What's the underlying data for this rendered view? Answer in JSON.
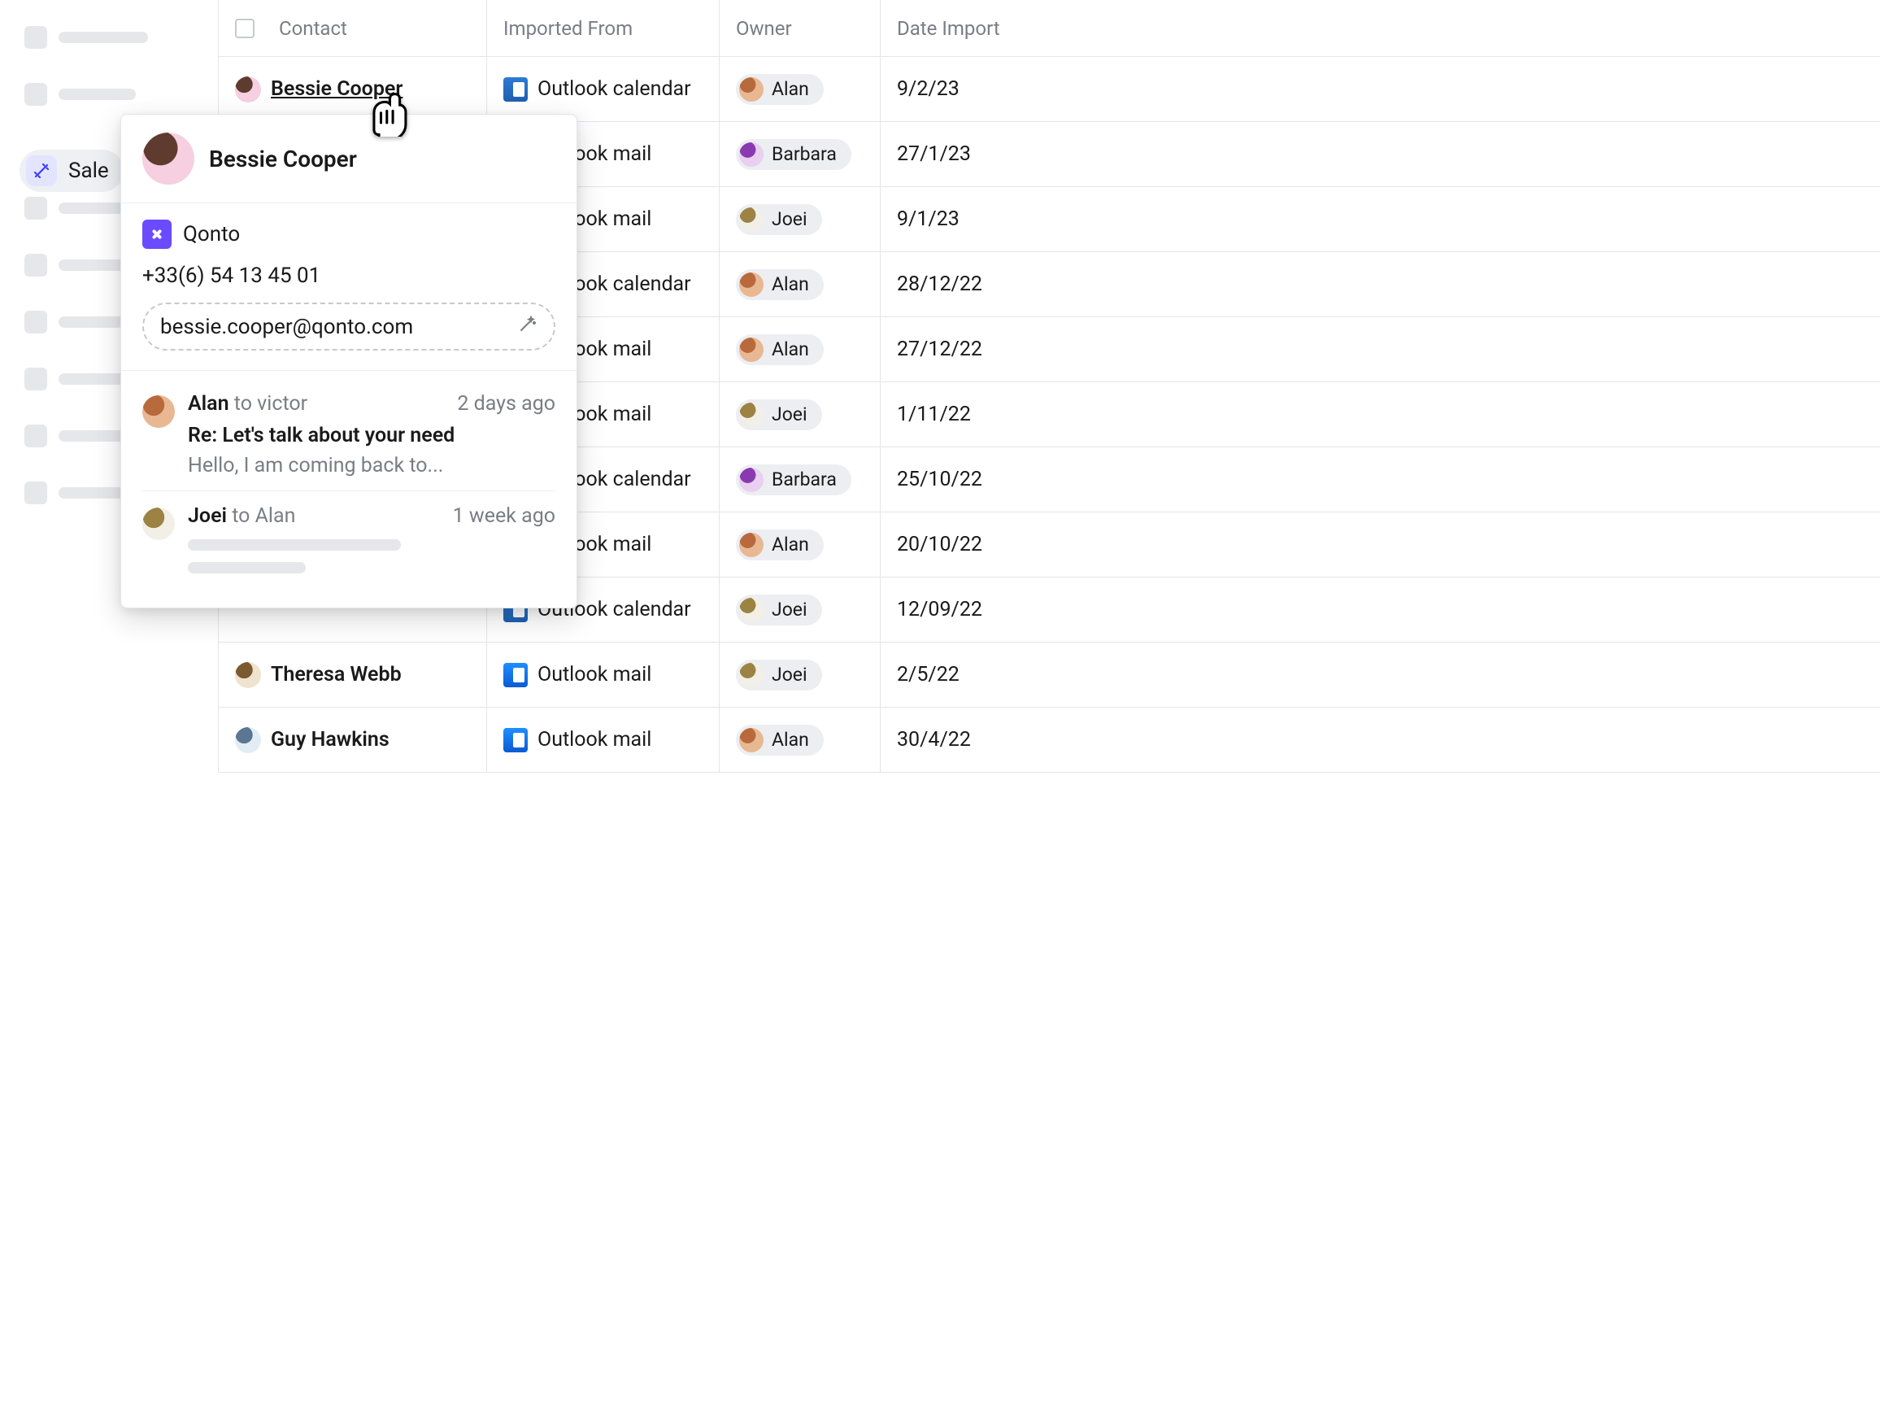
{
  "sidebar": {
    "active_label": "Sale"
  },
  "columns": {
    "contact": "Contact",
    "imported": "Imported From",
    "owner": "Owner",
    "date": "Date Import"
  },
  "sources": {
    "outlook_calendar": "Outlook calendar",
    "outlook_mail": "Outlook mail"
  },
  "rows": [
    {
      "contact": "Bessie Cooper",
      "source": "outlook_calendar",
      "owner": "Alan",
      "owner_avatar": "alan",
      "date": "9/2/23",
      "avatar": "bessie",
      "hovered": true
    },
    {
      "contact": "",
      "source": "outlook_mail",
      "owner": "Barbara",
      "owner_avatar": "barbara",
      "date": "27/1/23"
    },
    {
      "contact": "",
      "source": "outlook_mail",
      "owner": "Joei",
      "owner_avatar": "joei",
      "date": "9/1/23"
    },
    {
      "contact": "",
      "source": "outlook_calendar",
      "owner": "Alan",
      "owner_avatar": "alan",
      "date": "28/12/22"
    },
    {
      "contact": "",
      "source": "outlook_mail",
      "owner": "Alan",
      "owner_avatar": "alan",
      "date": "27/12/22"
    },
    {
      "contact": "",
      "source": "outlook_mail",
      "owner": "Joei",
      "owner_avatar": "joei",
      "date": "1/11/22"
    },
    {
      "contact": "",
      "source": "outlook_calendar",
      "owner": "Barbara",
      "owner_avatar": "barbara",
      "date": "25/10/22"
    },
    {
      "contact": "",
      "source": "outlook_mail",
      "owner": "Alan",
      "owner_avatar": "alan",
      "date": "20/10/22"
    },
    {
      "contact": "",
      "source": "outlook_calendar",
      "owner": "Joei",
      "owner_avatar": "joei",
      "date": "12/09/22"
    },
    {
      "contact": "Theresa Webb",
      "source": "outlook_mail",
      "owner": "Joei",
      "owner_avatar": "joei",
      "date": "2/5/22",
      "avatar": "theresa"
    },
    {
      "contact": "Guy Hawkins",
      "source": "outlook_mail",
      "owner": "Alan",
      "owner_avatar": "alan",
      "date": "30/4/22",
      "avatar": "guy"
    }
  ],
  "popover": {
    "name": "Bessie Cooper",
    "company": "Qonto",
    "phone": "+33(6) 54 13 45 01",
    "email": "bessie.cooper@qonto.com",
    "messages": [
      {
        "from": "Alan",
        "to": "to victor",
        "time": "2 days ago",
        "subject": "Re: Let's talk about your need",
        "snippet": "Hello, I am coming back to...",
        "avatar": "alan"
      },
      {
        "from": "Joei",
        "to": "to Alan",
        "time": "1 week ago",
        "skeleton": true,
        "avatar": "joei"
      }
    ]
  },
  "avatar_colors": {
    "bessie": {
      "bg": "#f6cfe0",
      "fg": "#5e3b2e"
    },
    "alan": {
      "bg": "#e8b893",
      "fg": "#b86a3d"
    },
    "barbara": {
      "bg": "#e9cff0",
      "fg": "#8a3ab0"
    },
    "joei": {
      "bg": "#f2efe6",
      "fg": "#9c8344"
    },
    "theresa": {
      "bg": "#efe3cf",
      "fg": "#7a5a2e"
    },
    "guy": {
      "bg": "#e3ecf4",
      "fg": "#5a7691"
    }
  }
}
